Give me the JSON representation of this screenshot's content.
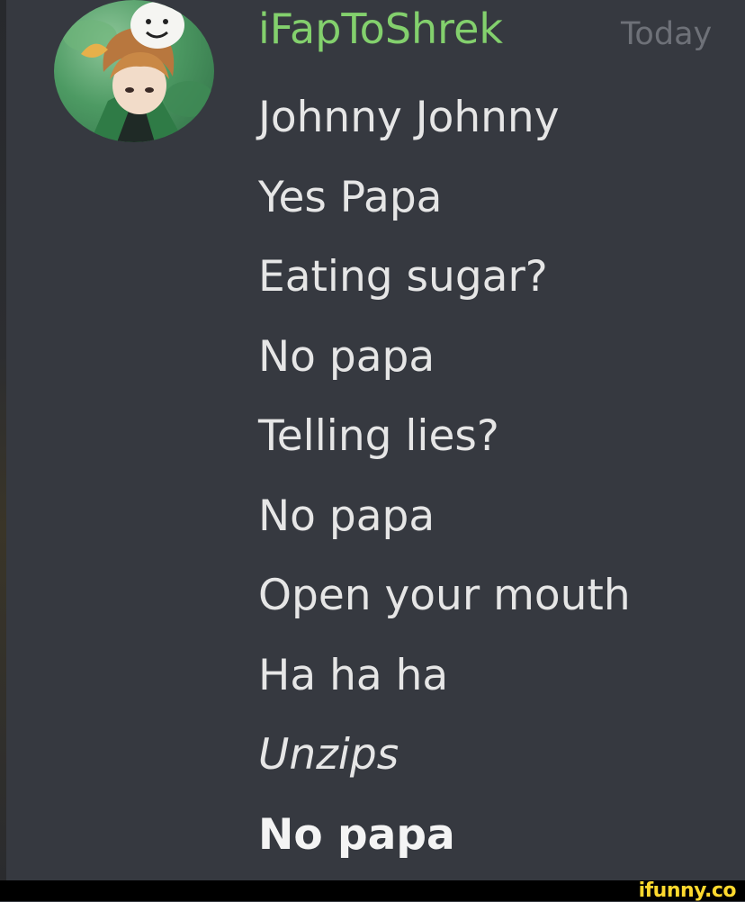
{
  "message": {
    "author": {
      "username": "iFapToShrek",
      "avatar": "avatar-anime-character-with-mask",
      "name_color": "#83d06d"
    },
    "timestamp": "Today",
    "lines": [
      {
        "text": "Johnny Johnny",
        "style": "normal"
      },
      {
        "text": "Yes Papa",
        "style": "normal"
      },
      {
        "text": "Eating sugar?",
        "style": "normal"
      },
      {
        "text": "No papa",
        "style": "normal"
      },
      {
        "text": "Telling lies?",
        "style": "normal"
      },
      {
        "text": "No papa",
        "style": "normal"
      },
      {
        "text": "Open your mouth",
        "style": "normal"
      },
      {
        "text": "Ha ha ha",
        "style": "normal"
      },
      {
        "text": "Unzips",
        "style": "italic"
      },
      {
        "text": "No papa",
        "style": "bold"
      }
    ]
  },
  "watermark": {
    "text": "ifunny.co",
    "color": "#ffd92e"
  },
  "colors": {
    "background": "#363940",
    "text": "#e6e6e6",
    "timestamp": "#6e7178"
  }
}
